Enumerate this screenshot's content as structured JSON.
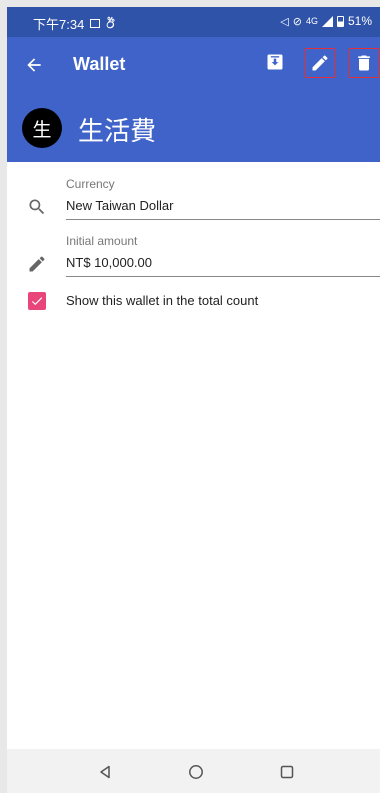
{
  "status_bar": {
    "time": "下午7:34",
    "network": "4G",
    "battery": "51%"
  },
  "app_bar": {
    "title": "Wallet",
    "back_icon": "arrow-back-icon",
    "archive_icon": "archive-icon",
    "edit_icon": "pencil-icon",
    "delete_icon": "trash-icon",
    "background": "#3f63c8"
  },
  "wallet": {
    "avatar_text": "生",
    "name": "生活費"
  },
  "form": {
    "currency": {
      "label": "Currency",
      "value": "New Taiwan Dollar",
      "icon": "search-icon"
    },
    "initial_amount": {
      "label": "Initial amount",
      "value": "NT$ 10,000.00",
      "icon": "pencil-icon"
    },
    "show_in_total": {
      "label": "Show this wallet in the total count",
      "checked": true,
      "color": "#e8457a"
    }
  },
  "nav_bar": {
    "back_icon": "triangle-back-icon",
    "home_icon": "circle-home-icon",
    "recents_icon": "square-recents-icon"
  }
}
